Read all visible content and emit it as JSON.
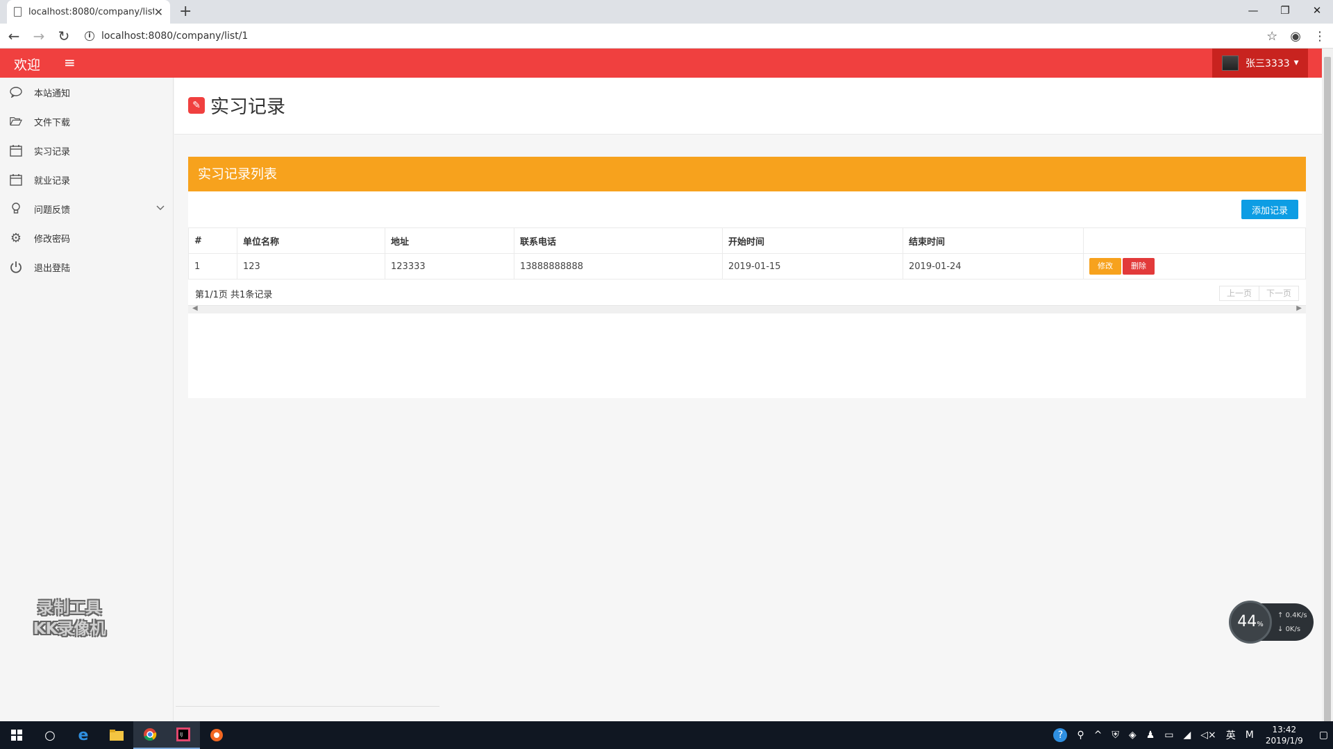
{
  "browser": {
    "tab_title": "localhost:8080/company/list/1",
    "url": "localhost:8080/company/list/1"
  },
  "header": {
    "brand": "欢迎",
    "user_name": "张三3333"
  },
  "sidebar": {
    "items": [
      {
        "label": "本站通知",
        "icon": "chat-bubble-icon"
      },
      {
        "label": "文件下载",
        "icon": "folder-open-icon"
      },
      {
        "label": "实习记录",
        "icon": "calendar-icon"
      },
      {
        "label": "就业记录",
        "icon": "calendar-icon"
      },
      {
        "label": "问题反馈",
        "icon": "lightbulb-icon"
      },
      {
        "label": "修改密码",
        "icon": "gear-icon"
      },
      {
        "label": "退出登陆",
        "icon": "power-icon"
      }
    ],
    "watermark_line1": "录制工具",
    "watermark_line2": "KK录像机"
  },
  "main": {
    "page_title": "实习记录",
    "panel_title": "实习记录列表",
    "add_button": "添加记录",
    "table": {
      "columns": [
        "#",
        "单位名称",
        "地址",
        "联系电话",
        "开始时间",
        "结束时间",
        ""
      ],
      "rows": [
        {
          "index": "1",
          "company": "123",
          "address": "123333",
          "phone": "13888888888",
          "start": "2019-01-15",
          "end": "2019-01-24"
        }
      ],
      "edit_label": "修改",
      "delete_label": "删除"
    },
    "pager_info": "第1/1页 共1条记录",
    "prev_label": "上一页",
    "next_label": "下一页"
  },
  "net_widget": {
    "percent": "44",
    "up": "0.4K/s",
    "down": "0K/s"
  },
  "taskbar": {
    "ime": "英",
    "time": "13:42",
    "date": "2019/1/9"
  },
  "colors": {
    "header_red": "#f0403f",
    "panel_orange": "#f7a21d",
    "add_blue": "#0d9de4",
    "delete_red": "#e23a3a"
  }
}
